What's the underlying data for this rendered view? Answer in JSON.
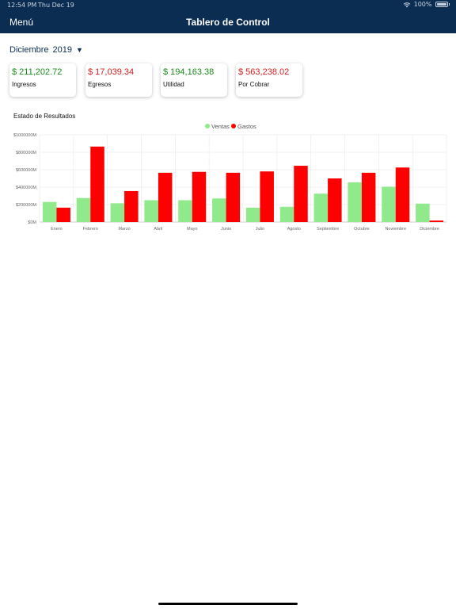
{
  "status_bar": {
    "time": "12:54 PM",
    "date": "Thu Dec 19",
    "battery": "100%"
  },
  "nav": {
    "menu_label": "Menú",
    "title": "Tablero de Control"
  },
  "period": {
    "month": "Diciembre",
    "year": "2019",
    "caret": "▼"
  },
  "cards": [
    {
      "amount": "$ 211,202.72",
      "label": "Ingresos",
      "color": "#1b8a1b"
    },
    {
      "amount": "$ 17,039.34",
      "label": "Egresos",
      "color": "#d32020"
    },
    {
      "amount": "$ 194,163.38",
      "label": "Utilidad",
      "color": "#1b8a1b"
    },
    {
      "amount": "$ 563,238.02",
      "label": "Por Cobrar",
      "color": "#d32020"
    }
  ],
  "chart_data": {
    "type": "bar",
    "title": "Estado de Resultados",
    "categories": [
      "Enero",
      "Febrero",
      "Marzo",
      "Abril",
      "Mayo",
      "Junio",
      "Julio",
      "Agosto",
      "Septiembre",
      "Octubre",
      "Noviembre",
      "Diciembre"
    ],
    "series": [
      {
        "name": "Ventas",
        "color": "#90e98a",
        "values": [
          230,
          275,
          215,
          250,
          250,
          270,
          165,
          175,
          325,
          455,
          405,
          211
        ]
      },
      {
        "name": "Gastos",
        "color": "#ff0000",
        "values": [
          165,
          865,
          355,
          565,
          575,
          565,
          580,
          645,
          500,
          565,
          625,
          17
        ]
      }
    ],
    "ylim": [
      0,
      1000
    ],
    "yticks": [
      0,
      200,
      400,
      600,
      800,
      1000
    ],
    "ytick_labels": [
      "$0M",
      "$200000M",
      "$400000M",
      "$600000M",
      "$800000M",
      "$1000000M"
    ],
    "legend_position": "top-center",
    "grid": true
  }
}
